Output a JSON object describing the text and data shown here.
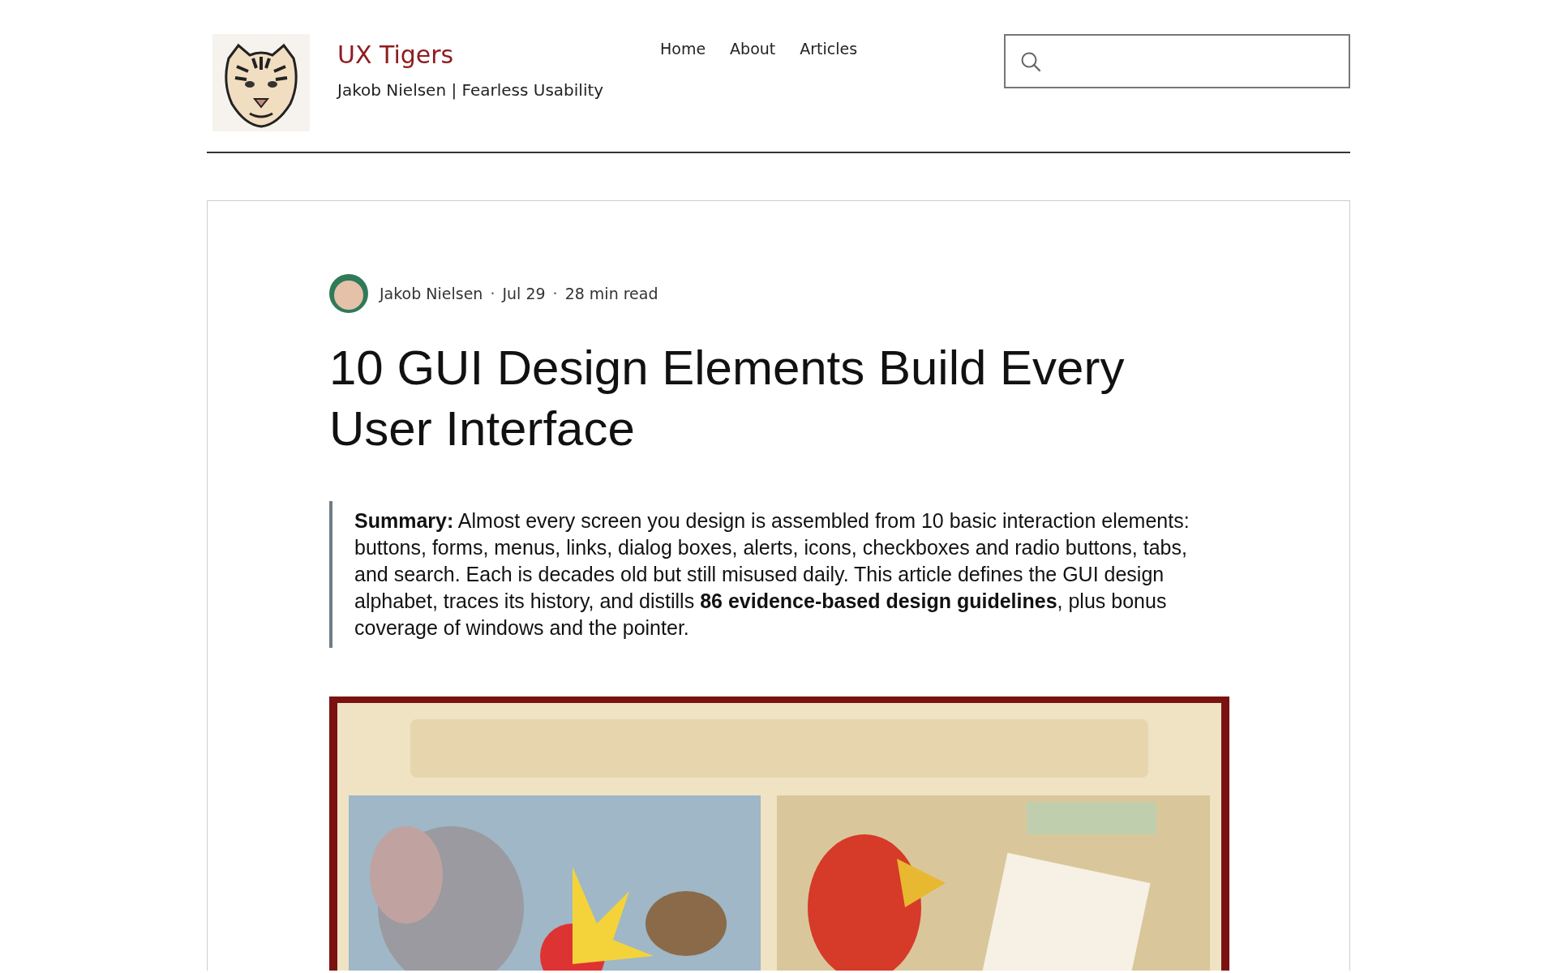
{
  "site": {
    "title": "UX Tigers",
    "tagline": "Jakob Nielsen | Fearless Usability"
  },
  "nav": [
    {
      "label": "Home"
    },
    {
      "label": "About"
    },
    {
      "label": "Articles"
    }
  ],
  "post": {
    "byline": [
      {
        "kind": "text",
        "text": "Jakob Nielsen"
      },
      {
        "kind": "separator",
        "text": "·"
      },
      {
        "kind": "text",
        "text": "Jul 29"
      },
      {
        "kind": "separator",
        "text": "·"
      },
      {
        "kind": "text",
        "text": "28 min read"
      }
    ],
    "title": "10 GUI Design Elements Build Every User Interface",
    "summary": "**Summary:** Almost every screen you design is assembled from 10 basic interaction elements: buttons, forms, menus, links, dialog boxes, alerts, icons, checkboxes and radio buttons, tabs, and search. Each is decades old but still misused daily. This article defines the GUI design alphabet, traces its history, and distills **86 evidence-based design guidelines**, plus bonus coverage of windows and the pointer."
  }
}
